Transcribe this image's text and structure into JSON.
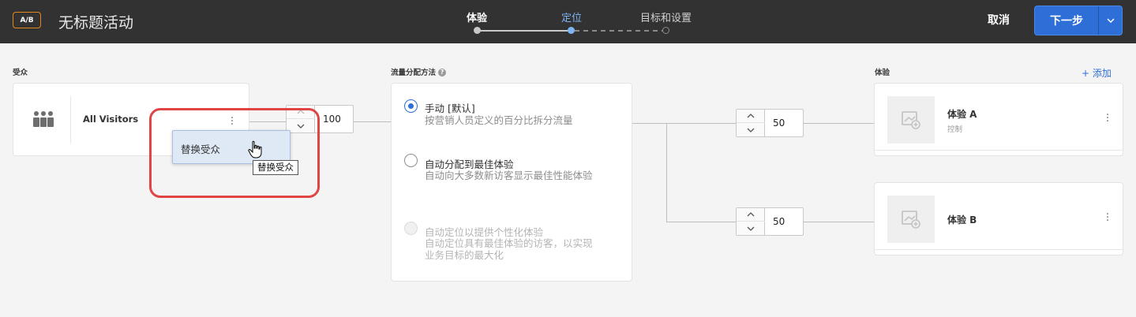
{
  "header": {
    "badge": "A/B",
    "title": "无标题活动",
    "steps": [
      "体验",
      "定位",
      "目标和设置"
    ],
    "cancel": "取消",
    "next": "下一步"
  },
  "sections": {
    "audience": "受众",
    "traffic": "流量分配方法",
    "experience": "体验",
    "add": "+ 添加"
  },
  "audience_card": {
    "name": "All Visitors"
  },
  "audience_stepper": {
    "value": "100"
  },
  "traffic_options": [
    {
      "title": "手动 [默认]",
      "desc": "按营销人员定义的百分比拆分流量",
      "selected": true
    },
    {
      "title": "自动分配到最佳体验",
      "desc": "自动向大多数新访客显示最佳性能体验",
      "selected": false
    },
    {
      "title": "自动定位以提供个性化体验",
      "desc1": "自动定位具有最佳体验的访客，以实现",
      "desc2": "业务目标的最大化",
      "disabled": true
    }
  ],
  "experiences": [
    {
      "name": "体验 A",
      "sub": "控制",
      "split": "50"
    },
    {
      "name": "体验 B",
      "sub": "",
      "split": "50"
    }
  ],
  "menu": {
    "item": "替换受众",
    "tooltip": "替换受众"
  },
  "colors": {
    "accent": "#2d6ed7",
    "header": "#323232",
    "badge": "#e68619",
    "highlight": "#e04545"
  }
}
